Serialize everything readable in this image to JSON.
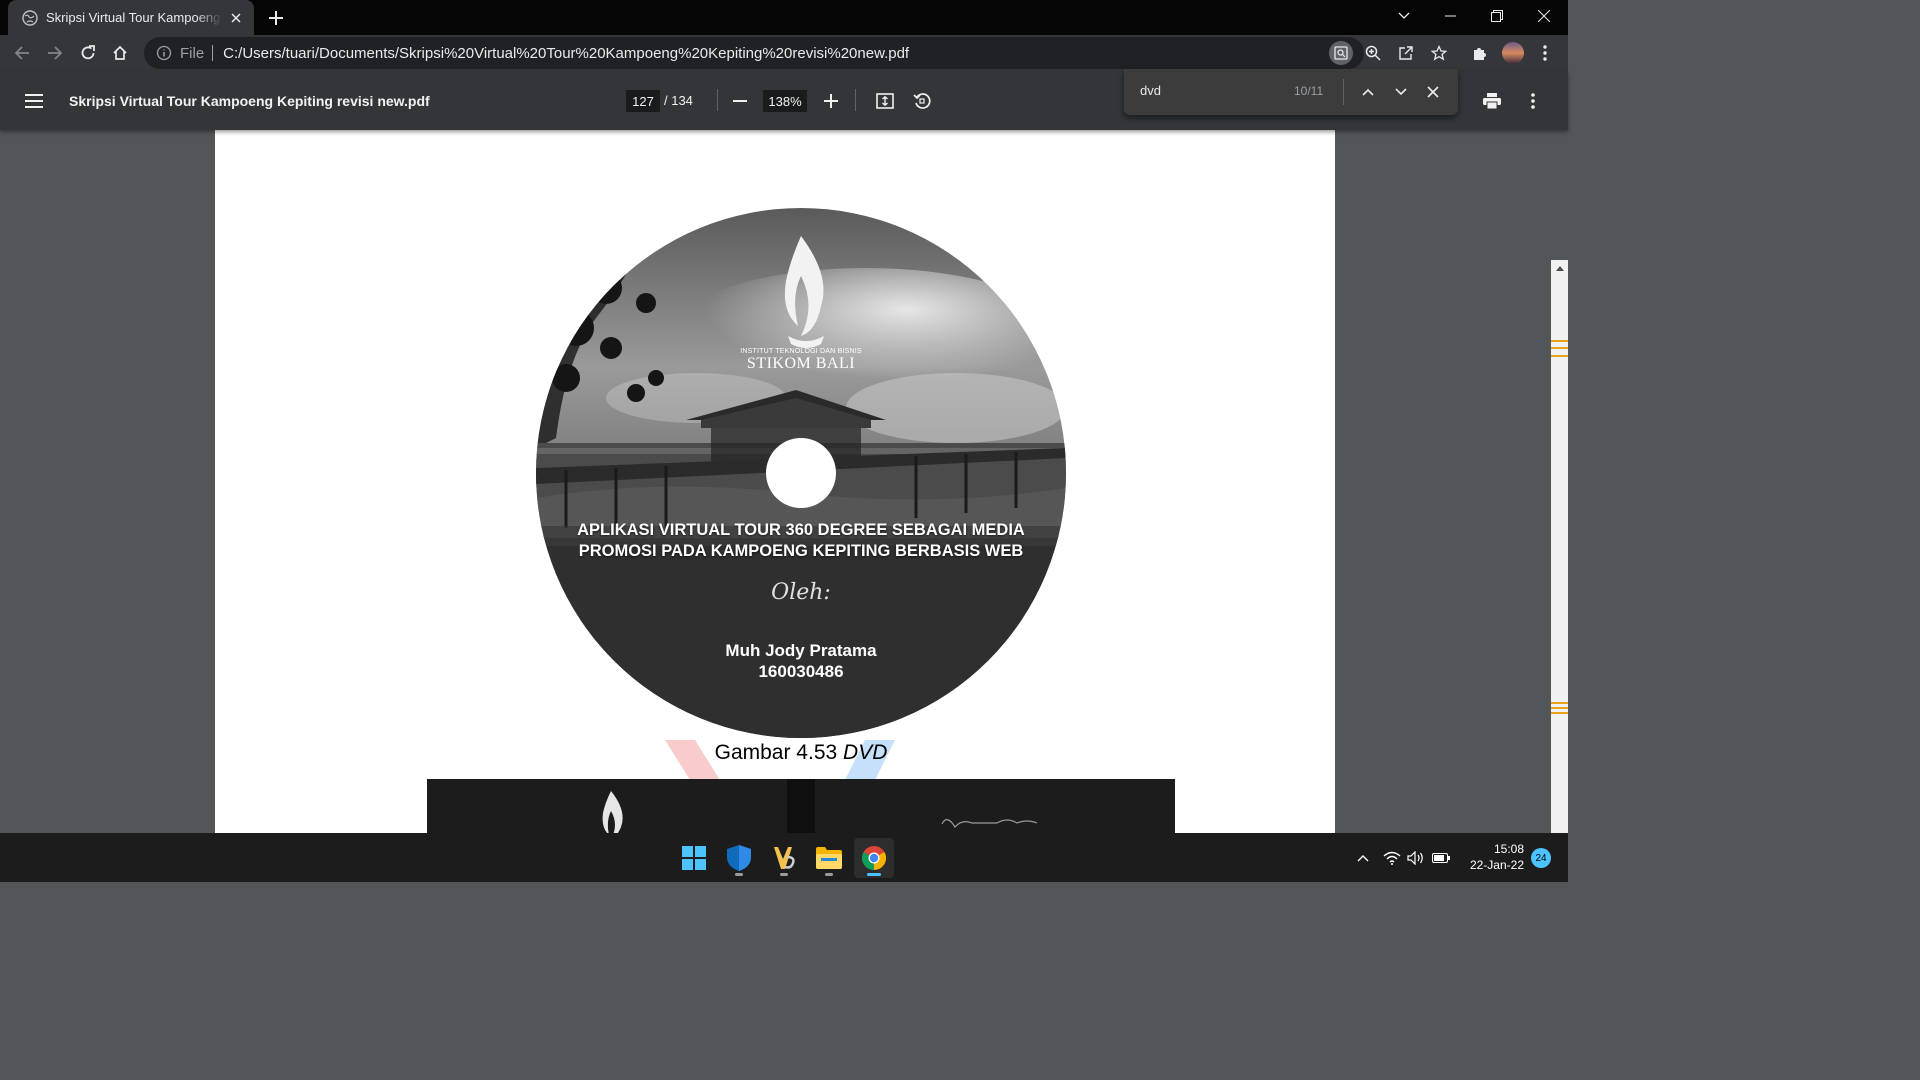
{
  "browser": {
    "tab_title": "Skripsi Virtual Tour Kampoeng Kepiting revisi new.pdf",
    "address_scheme": "File",
    "address_url": "C:/Users/tuari/Documents/Skripsi%20Virtual%20Tour%20Kampoeng%20Kepiting%20revisi%20new.pdf"
  },
  "pdf_toolbar": {
    "title": "Skripsi Virtual Tour Kampoeng Kepiting revisi new.pdf",
    "current_page": "127",
    "total_pages": "/ 134",
    "zoom": "138%"
  },
  "find_bar": {
    "query": "dvd",
    "match_count": "10/11"
  },
  "document": {
    "disc_logo_small": "INSTITUT TEKNOLOGI DAN BISNIS",
    "disc_logo_big": "STIKOM BALI",
    "disc_title": "APLIKASI VIRTUAL TOUR 360 DEGREE SEBAGAI MEDIA PROMOSI PADA KAMPOENG KEPITING BERBASIS WEB",
    "disc_oleh": "Oleh:",
    "author_name": "Muh Jody Pratama",
    "author_id": "160030486",
    "caption_prefix": "Gambar 4.53",
    "caption_italic": "DVD",
    "cover_script": "Virtual Tour"
  },
  "taskbar": {
    "apps": [
      "windows-start",
      "windows-security",
      "sticky-notes-app",
      "file-explorer",
      "google-chrome"
    ],
    "time": "15:08",
    "date": "22-Jan-22",
    "notification_count": "24"
  },
  "colors": {
    "pdf_background": "#525659",
    "pdf_toolbar": "#323639",
    "find_highlight": "#e8a317",
    "taskbar": "#1c1c1c"
  }
}
